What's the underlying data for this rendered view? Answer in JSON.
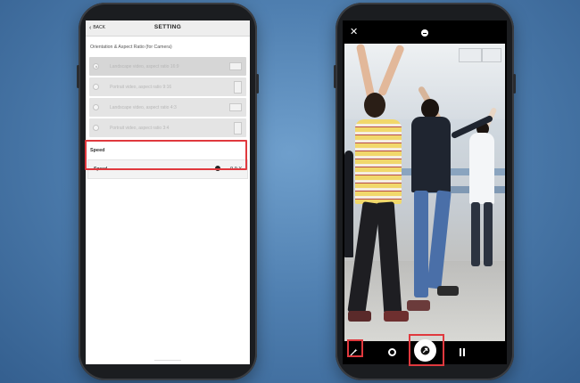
{
  "settings_screen": {
    "back_label": "BACK",
    "title": "SETTING",
    "orientation_section_title": "Orientation & Aspect Ratio (for Camera)",
    "options": [
      {
        "label": "Landscape video, aspect ratio 16:9",
        "ratio_icon": "landscape-ratio-icon",
        "selected": true
      },
      {
        "label": "Portrait video, aspect ratio 9:16",
        "ratio_icon": "portrait-ratio-icon",
        "selected": false
      },
      {
        "label": "Landscape video, aspect ratio 4:3",
        "ratio_icon": "landscape-ratio-icon",
        "selected": false
      },
      {
        "label": "Portrait video, aspect ratio 3:4",
        "ratio_icon": "portrait-ratio-icon",
        "selected": false
      }
    ],
    "speed_section_title": "Speed",
    "speed_label": "Speed",
    "speed_value": "9.9 X",
    "speed_level_fraction": 0.95
  },
  "camera_screen": {
    "icons": [
      "close-icon",
      "camera-pause-icon",
      "magic-wand-icon",
      "settings-icon",
      "shutter-icon",
      "pause-icon"
    ]
  },
  "colors": {
    "highlight": "#e0393e",
    "background": "#4f7fb0",
    "phone_body": "#1b1d20"
  }
}
